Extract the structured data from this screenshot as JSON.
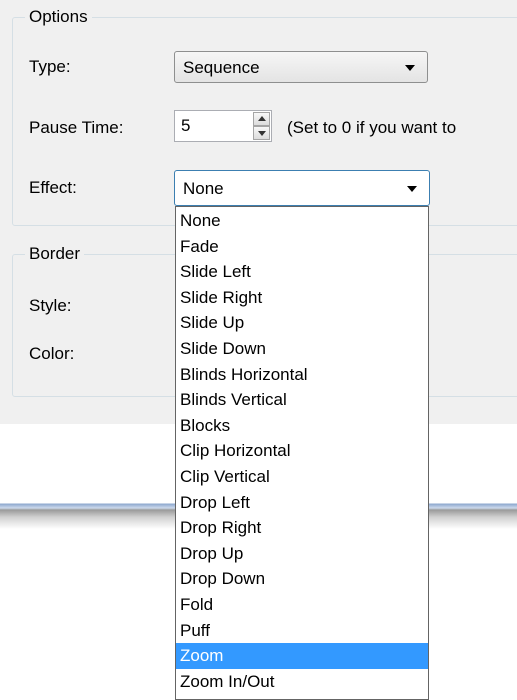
{
  "options_group": {
    "title": "Options",
    "type_label": "Type:",
    "type_value": "Sequence",
    "pause_label": "Pause Time:",
    "pause_value": "5",
    "pause_hint": "(Set to 0 if you want to",
    "effect_label": "Effect:",
    "effect_value": "None"
  },
  "border_group": {
    "title": "Border",
    "style_label": "Style:",
    "color_label": "Color:"
  },
  "effect_dropdown": {
    "selected": "Zoom",
    "options": [
      "None",
      "Fade",
      "Slide Left",
      "Slide Right",
      "Slide Up",
      "Slide Down",
      "Blinds Horizontal",
      "Blinds Vertical",
      "Blocks",
      "Clip Horizontal",
      "Clip Vertical",
      "Drop Left",
      "Drop Right",
      "Drop Up",
      "Drop Down",
      "Fold",
      "Puff",
      "Zoom",
      "Zoom In/Out"
    ]
  },
  "colors": {
    "dialog_bg": "#f0f0f0",
    "highlight": "#3399ff",
    "groupbox_border": "#d5dfe5"
  },
  "icons": {
    "combo_arrow": "chevron-down-icon",
    "spin_up": "arrow-up-icon",
    "spin_down": "arrow-down-icon"
  }
}
